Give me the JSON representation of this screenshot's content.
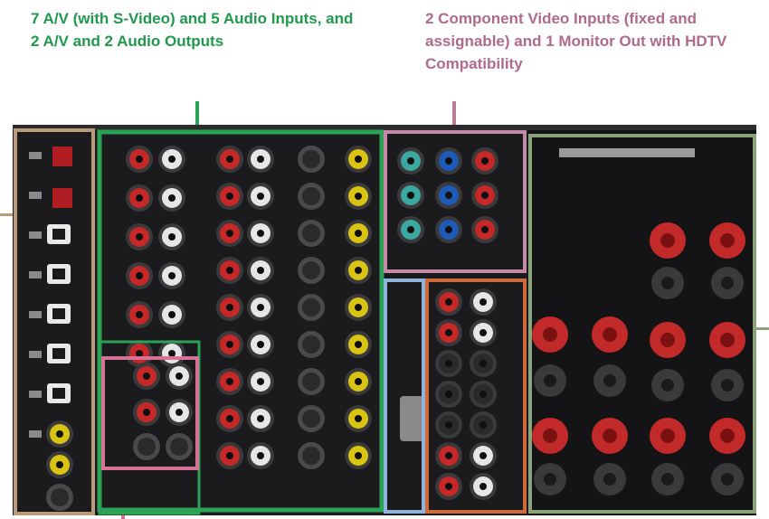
{
  "captions": {
    "left": "7 A/V (with S-Video) and 5 Audio Inputs, and 2 A/V and 2 Audio Outputs",
    "right": "2 Component Video Inputs (fixed and assignable) and 1 Monitor Out with HDTV Compatibility"
  },
  "highlight_colors": {
    "av_inputs_outputs": "#2aa356",
    "component_video": "#c48aa8",
    "left_digital": "#b99b78",
    "speaker_terminals": "#8aa37a",
    "audio_inputs": "#d57295",
    "rs232c": "#8fb3d9",
    "pre_outputs": "#d0693b"
  },
  "jack_colors": {
    "red": "#c62828",
    "white": "#e6e6e6",
    "yellow": "#d9c313",
    "blue": "#1e5ab8",
    "green_y": "#3aa7a0",
    "black": "#2a2a2a",
    "speaker_red": "#c22a2a"
  }
}
